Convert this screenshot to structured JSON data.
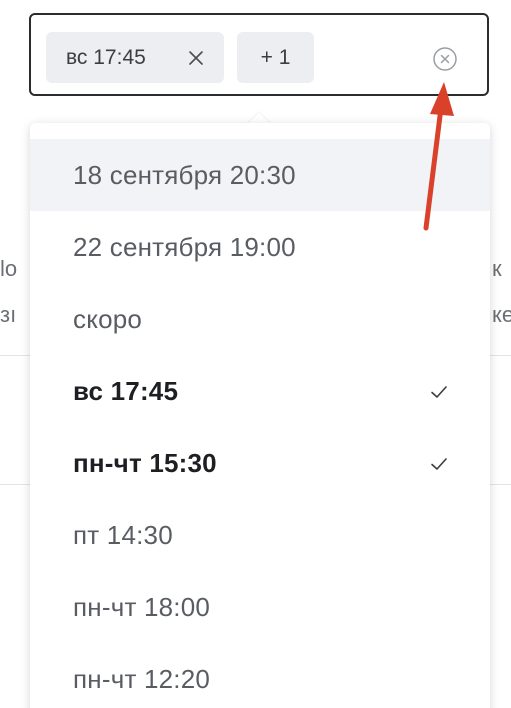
{
  "select": {
    "tags": [
      {
        "label": "вс 17:45"
      }
    ],
    "more_tag": "+ 1"
  },
  "background": {
    "left_fragments": [
      "lo",
      "зı"
    ],
    "right_fragments": [
      "к",
      "ке"
    ]
  },
  "dropdown": {
    "options": [
      {
        "label": "18 сентября 20:30",
        "selected": false,
        "highlighted": true
      },
      {
        "label": "22 сентября 19:00",
        "selected": false,
        "highlighted": false
      },
      {
        "label": "скоро",
        "selected": false,
        "highlighted": false
      },
      {
        "label": "вс 17:45",
        "selected": true,
        "highlighted": false
      },
      {
        "label": "пн-чт 15:30",
        "selected": true,
        "highlighted": false
      },
      {
        "label": "пт 14:30",
        "selected": false,
        "highlighted": false
      },
      {
        "label": "пн-чт 18:00",
        "selected": false,
        "highlighted": false
      },
      {
        "label": "пн-чт 12:20",
        "selected": false,
        "highlighted": false
      }
    ]
  },
  "icons": {
    "chip_remove": "close-icon",
    "clear": "clear-circle-icon",
    "selected_mark": "check-icon"
  },
  "colors": {
    "field_border": "#2a2d30",
    "chip_bg": "#eceef1",
    "option_hover_bg": "#f2f3f7",
    "annotation_arrow": "#d9412b"
  }
}
